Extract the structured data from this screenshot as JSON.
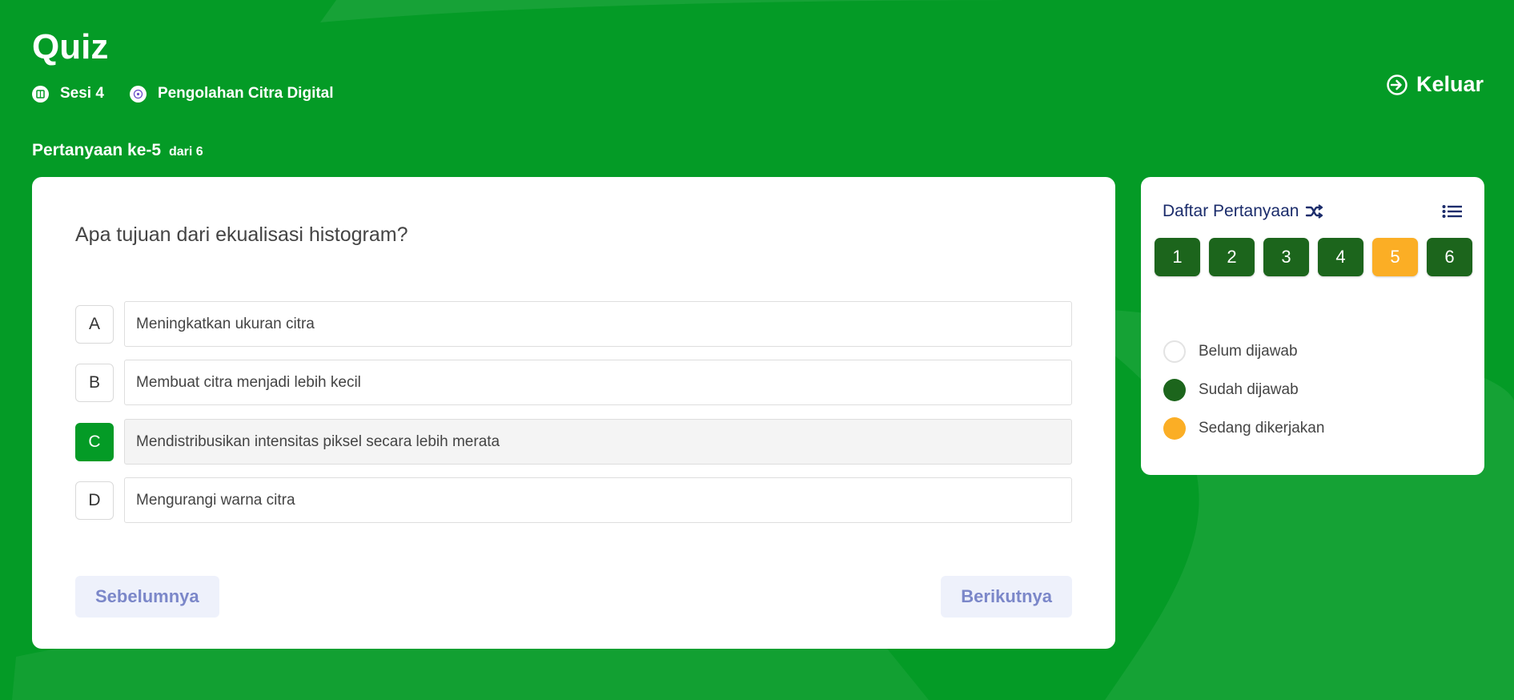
{
  "header": {
    "title": "Quiz",
    "session_label": "Sesi 4",
    "course_label": "Pengolahan Citra Digital",
    "exit_label": "Keluar"
  },
  "progress": {
    "question_label": "Pertanyaan ke-5",
    "total_label": "dari 6"
  },
  "question": {
    "text": "Apa tujuan dari ekualisasi histogram?",
    "options": [
      {
        "letter": "A",
        "text": "Meningkatkan ukuran citra"
      },
      {
        "letter": "B",
        "text": "Membuat citra menjadi lebih kecil"
      },
      {
        "letter": "C",
        "text": "Mendistribusikan intensitas piksel secara lebih merata"
      },
      {
        "letter": "D",
        "text": "Mengurangi warna citra"
      }
    ],
    "selected": "C"
  },
  "navigation": {
    "prev_label": "Sebelumnya",
    "next_label": "Berikutnya"
  },
  "sidebar": {
    "title": "Daftar Pertanyaan",
    "numbers": [
      "1",
      "2",
      "3",
      "4",
      "5",
      "6"
    ],
    "current": "5",
    "legend": [
      {
        "label": "Belum dijawab",
        "status": "unanswered"
      },
      {
        "label": "Sudah dijawab",
        "status": "answered"
      },
      {
        "label": "Sedang dikerjakan",
        "status": "current"
      }
    ]
  },
  "colors": {
    "background": "#049b26",
    "answered": "#1c651c",
    "current": "#fbae25",
    "selected_option": "#049b26",
    "nav_button_text": "#7b87c9",
    "sidebar_title": "#1b2c6b"
  },
  "icons": {
    "session": "book-icon",
    "course": "course-icon",
    "exit": "exit-arrow-icon",
    "shuffle": "shuffle-icon",
    "list": "list-icon"
  }
}
